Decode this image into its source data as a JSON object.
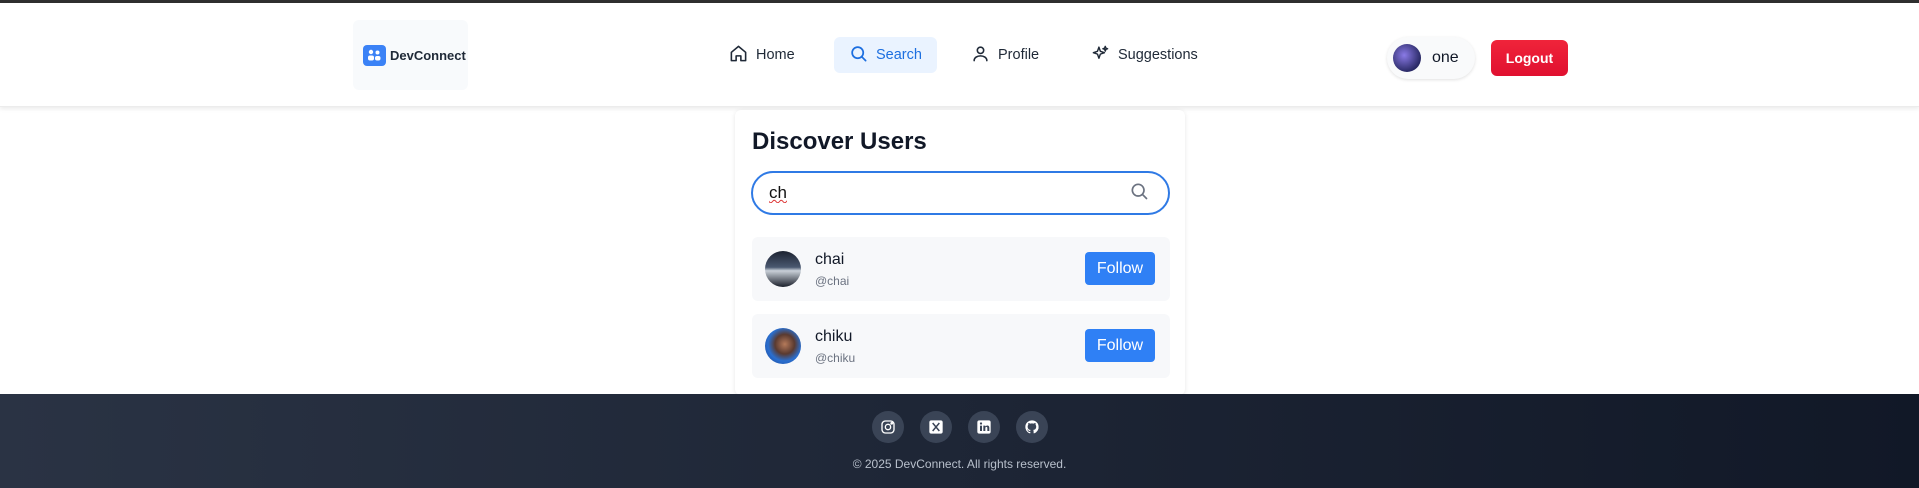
{
  "app": {
    "brand": "DevConnect"
  },
  "nav": {
    "items": [
      {
        "label": "Home",
        "icon": "home-icon"
      },
      {
        "label": "Search",
        "icon": "search-icon",
        "active": true
      },
      {
        "label": "Profile",
        "icon": "user-icon"
      },
      {
        "label": "Suggestions",
        "icon": "sparkles-icon"
      }
    ]
  },
  "user": {
    "name": "one"
  },
  "actions": {
    "logout_label": "Logout"
  },
  "discover": {
    "title": "Discover Users",
    "search_value": "ch",
    "results": [
      {
        "name": "chai",
        "handle": "@chai",
        "follow_label": "Follow"
      },
      {
        "name": "chiku",
        "handle": "@chiku",
        "follow_label": "Follow"
      }
    ]
  },
  "footer": {
    "social": [
      "instagram-icon",
      "x-icon",
      "linkedin-icon",
      "github-icon"
    ],
    "copyright": "© 2025 DevConnect. All rights reserved."
  },
  "colors": {
    "accent": "#2f80f5",
    "logout": "#e81232",
    "footer_dark": "#111827"
  }
}
